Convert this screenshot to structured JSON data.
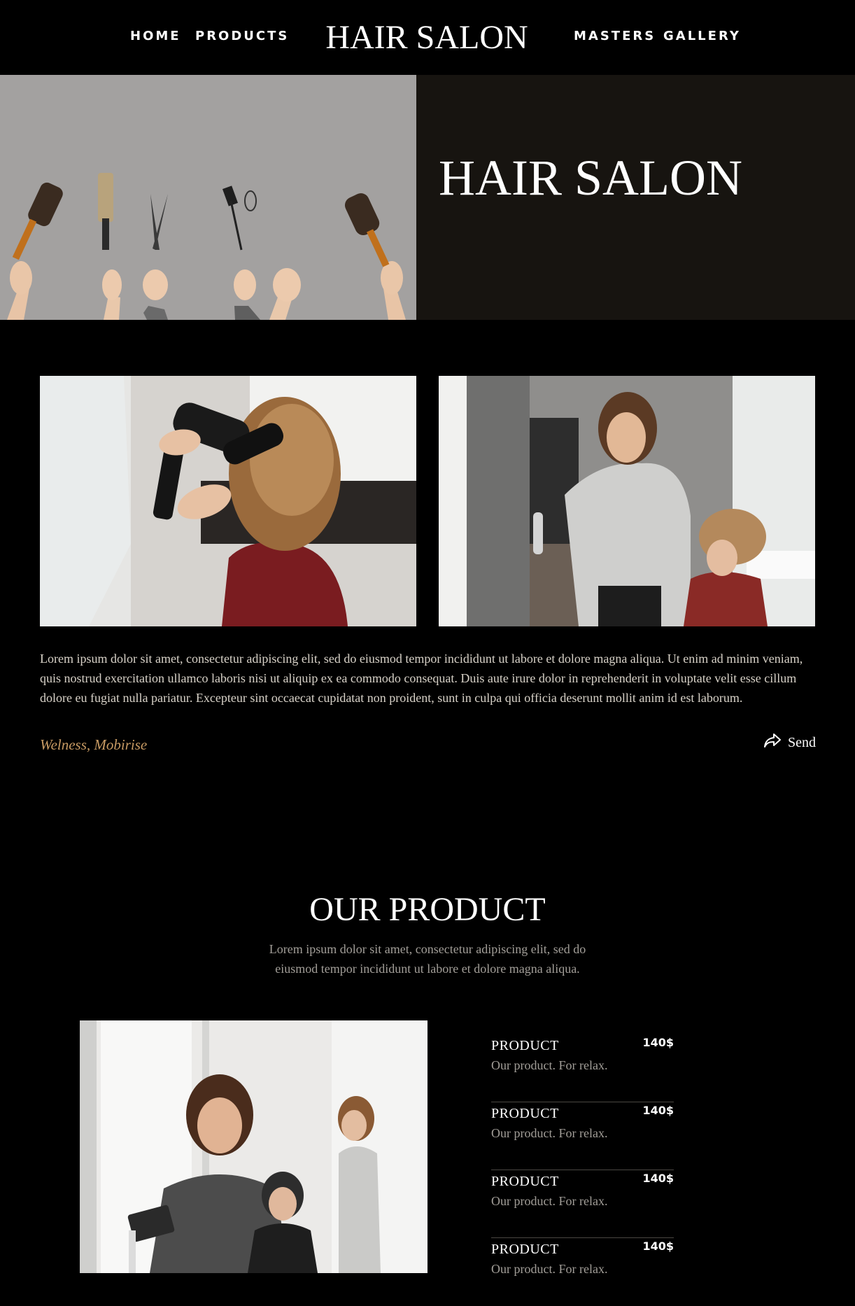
{
  "nav": {
    "home": "HOME",
    "products": "PRODUCTS",
    "brand": "HAIR SALON",
    "masters": "MASTERS",
    "gallery": "GALLERY"
  },
  "hero": {
    "title": "HAIR SALON",
    "image_alt": "hands holding hair tools"
  },
  "article": {
    "left_image_alt": "stylist blow-drying hair",
    "right_image_alt": "stylist spraying hair",
    "text": "Lorem ipsum dolor sit amet, consectetur adipiscing elit, sed do eiusmod tempor incididunt ut labore et dolore magna aliqua. Ut enim ad minim veniam, quis nostrud exercitation ullamco laboris nisi ut aliquip ex ea commodo consequat. Duis aute irure dolor in reprehenderit in voluptate velit esse cillum dolore eu fugiat nulla pariatur. Excepteur sint occaecat cupidatat non proident, sunt in culpa qui officia deserunt mollit anim id est laborum.",
    "tags": "Welness, Mobirise",
    "send_label": "Send",
    "send_icon": "share-arrow-icon"
  },
  "products_section": {
    "title": "OUR PRODUCT",
    "subtitle": "Lorem ipsum dolor sit amet, consectetur adipiscing elit, sed do eiusmod tempor incididunt ut labore et dolore magna aliqua.",
    "image_alt": "stylist with tablet in salon",
    "items": [
      {
        "name": "PRODUCT",
        "price": "140$",
        "desc": "Our product. For relax."
      },
      {
        "name": "PRODUCT",
        "price": "140$",
        "desc": "Our product. For relax."
      },
      {
        "name": "PRODUCT",
        "price": "140$",
        "desc": "Our product. For relax."
      },
      {
        "name": "PRODUCT",
        "price": "140$",
        "desc": "Our product. For relax."
      }
    ]
  },
  "colors": {
    "background": "#000000",
    "hero_panel": "#171410",
    "accent": "#c79a63",
    "muted_text": "#a29e98"
  }
}
